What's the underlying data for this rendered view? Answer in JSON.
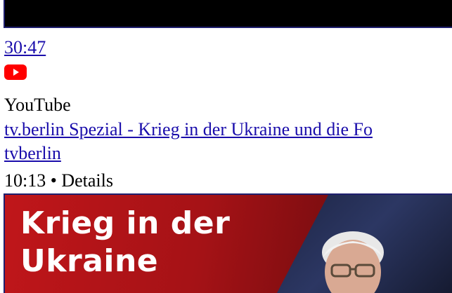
{
  "result": {
    "duration": "30:47",
    "source_icon": "youtube-icon",
    "source": "YouTube",
    "title": "tv.berlin Spezial - Krieg in der Ukraine und die Fo",
    "channel": "tvberlin",
    "meta": "10:13 • Details"
  },
  "thumbnail": {
    "headline_line1": "Krieg in der",
    "headline_line2": "Ukraine"
  },
  "colors": {
    "link": "#1a0dab",
    "youtube_red": "#ff0000",
    "border": "#1f1f6e"
  }
}
